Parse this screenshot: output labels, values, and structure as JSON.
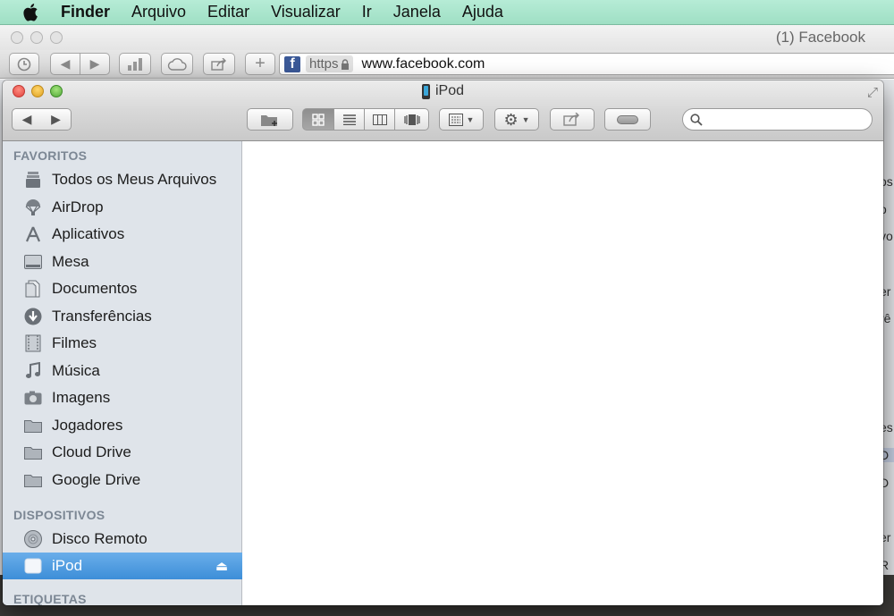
{
  "menubar": {
    "app": "Finder",
    "items": [
      "Arquivo",
      "Editar",
      "Visualizar",
      "Ir",
      "Janela",
      "Ajuda"
    ]
  },
  "safari": {
    "title": "(1) Facebook",
    "https_label": "https",
    "url": "www.facebook.com",
    "right_fragments": [
      "os",
      "o",
      "vo",
      "er",
      "rê",
      "es",
      "D",
      "D",
      "er",
      "R"
    ]
  },
  "finder": {
    "title": "iPod",
    "search_placeholder": "",
    "sidebar": {
      "favorites_header": "FAVORITOS",
      "favorites": [
        {
          "label": "Todos os Meus Arquivos",
          "icon": "all-files-icon"
        },
        {
          "label": "AirDrop",
          "icon": "airdrop-icon"
        },
        {
          "label": "Aplicativos",
          "icon": "applications-icon"
        },
        {
          "label": "Mesa",
          "icon": "desktop-icon"
        },
        {
          "label": "Documentos",
          "icon": "documents-icon"
        },
        {
          "label": "Transferências",
          "icon": "downloads-icon"
        },
        {
          "label": "Filmes",
          "icon": "movies-icon"
        },
        {
          "label": "Música",
          "icon": "music-icon"
        },
        {
          "label": "Imagens",
          "icon": "pictures-icon"
        },
        {
          "label": "Jogadores",
          "icon": "folder-icon"
        },
        {
          "label": "Cloud Drive",
          "icon": "folder-icon"
        },
        {
          "label": "Google Drive",
          "icon": "folder-icon"
        }
      ],
      "devices_header": "DISPOSITIVOS",
      "devices": [
        {
          "label": "Disco Remoto",
          "icon": "remote-disc-icon"
        },
        {
          "label": "iPod",
          "icon": "ipod-device-icon",
          "selected": true
        }
      ],
      "tags_header": "ETIQUETAS"
    }
  },
  "colors": {
    "menubar": "#a8e5cb",
    "sidebar": "#dfe4ea",
    "selection": "#3d8ed8",
    "section_header": "#7c8794"
  }
}
